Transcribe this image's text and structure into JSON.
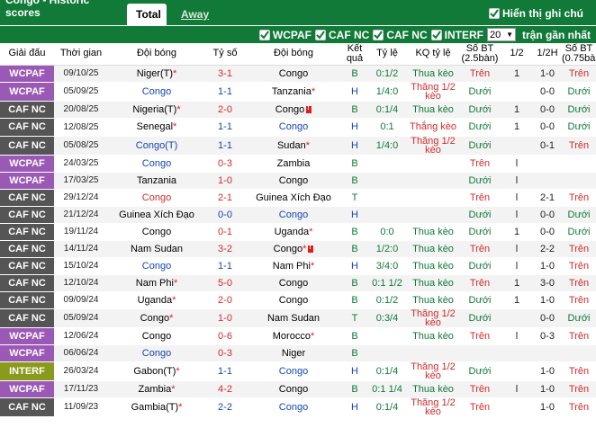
{
  "header": {
    "title": "Congo - Historic scores",
    "tabs": [
      {
        "label": "Total",
        "active": true
      },
      {
        "label": "Away",
        "active": false
      }
    ],
    "show_comment": "Hiển thị ghi chú"
  },
  "filters": {
    "items": [
      "WCPAF",
      "CAF NC",
      "CAF NC",
      "INTERF"
    ],
    "count_value": "20",
    "count_suffix": "trận gần nhất"
  },
  "columns": [
    "Giải đấu",
    "Thời gian",
    "Đội bóng",
    "Tỷ số",
    "Đội bóng",
    "Kết quả",
    "Tỷ lệ",
    "KQ tỷ lệ",
    "Số BT (2.5bàn)",
    "1/2",
    "1/2H",
    "Số BT (0.75bàn)"
  ],
  "colors": {
    "wcpaf": "#9b59b6",
    "cafnc": "#555555",
    "interf": "#8a9a1c",
    "header_green": "#117a38"
  },
  "rows": [
    {
      "league": "WCPAF",
      "date": "09/10/25",
      "home": "Niger(T)",
      "home_star": true,
      "home_congo": false,
      "score": "3-1",
      "score_color": "red",
      "away": "Congo",
      "away_star": false,
      "away_congo": false,
      "loc": "B",
      "line": "0:1/2",
      "res": "Thua kèo",
      "res_type": "thua",
      "ou": "Trên",
      "half": "1",
      "ht": "1-0",
      "ou2": "Trên"
    },
    {
      "league": "WCPAF",
      "date": "05/09/25",
      "home": "Congo",
      "home_star": false,
      "home_congo": true,
      "score": "1-1",
      "score_color": "blue",
      "away": "Tanzania",
      "away_star": true,
      "away_congo": false,
      "loc": "H",
      "line": "1/4:0",
      "res": "Thắng 1/2 kèo",
      "res_type": "thang",
      "ou": "Dưới",
      "half": "",
      "ht": "0-0",
      "ou2": "Dưới"
    },
    {
      "league": "CAF NC",
      "date": "20/08/25",
      "home": "Nigeria(T)",
      "home_star": true,
      "home_congo": false,
      "score": "2-0",
      "score_color": "red",
      "away": "Congo",
      "away_star": false,
      "away_congo": false,
      "away_card": true,
      "loc": "B",
      "line": "0:1/4",
      "res": "Thua kèo",
      "res_type": "thua",
      "ou": "Dưới",
      "half": "1",
      "ht": "0-0",
      "ou2": "Dưới"
    },
    {
      "league": "CAF NC",
      "date": "12/08/25",
      "home": "Senegal",
      "home_star": true,
      "home_congo": false,
      "score": "1-1",
      "score_color": "blue",
      "away": "Congo",
      "away_star": false,
      "away_congo": true,
      "loc": "H",
      "line": "0:1",
      "res": "Thắng kèo",
      "res_type": "thang",
      "ou": "Dưới",
      "half": "1",
      "ht": "0-0",
      "ou2": "Dưới"
    },
    {
      "league": "CAF NC",
      "date": "05/08/25",
      "home": "Congo(T)",
      "home_star": false,
      "home_congo": true,
      "score": "1-1",
      "score_color": "blue",
      "away": "Sudan",
      "away_star": true,
      "away_congo": false,
      "loc": "H",
      "line": "1/4:0",
      "res": "Thắng 1/2 kèo",
      "res_type": "thang",
      "ou": "Dưới",
      "half": "",
      "ht": "0-1",
      "ou2": "Trên"
    },
    {
      "league": "WCPAF",
      "date": "24/03/25",
      "home": "Congo",
      "home_star": false,
      "home_congo": true,
      "score": "0-3",
      "score_color": "red",
      "away": "Zambia",
      "away_star": false,
      "away_congo": false,
      "loc": "B",
      "line": "",
      "res": "",
      "res_type": "",
      "ou": "Trên",
      "half": "l",
      "ht": "",
      "ou2": ""
    },
    {
      "league": "WCPAF",
      "date": "17/03/25",
      "home": "Tanzania",
      "home_star": false,
      "home_congo": false,
      "score": "1-0",
      "score_color": "red",
      "away": "Congo",
      "away_star": false,
      "away_congo": false,
      "loc": "B",
      "line": "",
      "res": "",
      "res_type": "",
      "ou": "Dưới",
      "half": "l",
      "ht": "",
      "ou2": ""
    },
    {
      "league": "CAF NC",
      "date": "29/12/24",
      "home": "Congo",
      "home_star": false,
      "home_congo": false,
      "home_red": true,
      "score": "2-1",
      "score_color": "red",
      "away": "Guinea Xích Đạo",
      "away_star": false,
      "away_congo": false,
      "loc": "T",
      "line": "",
      "res": "",
      "res_type": "",
      "ou": "Trên",
      "half": "l",
      "ht": "2-1",
      "ou2": "Trên"
    },
    {
      "league": "CAF NC",
      "date": "21/12/24",
      "home": "Guinea Xích Đạo",
      "home_star": false,
      "home_congo": false,
      "score": "0-0",
      "score_color": "blue",
      "away": "Congo",
      "away_star": false,
      "away_congo": true,
      "loc": "H",
      "line": "",
      "res": "",
      "res_type": "",
      "ou": "Dưới",
      "half": "l",
      "ht": "0-0",
      "ou2": "Dưới"
    },
    {
      "league": "CAF NC",
      "date": "19/11/24",
      "home": "Congo",
      "home_star": false,
      "home_congo": false,
      "score": "0-1",
      "score_color": "red",
      "away": "Uganda",
      "away_star": true,
      "away_congo": false,
      "loc": "B",
      "line": "0:0",
      "res": "Thua kèo",
      "res_type": "thua",
      "ou": "Dưới",
      "half": "1",
      "ht": "0-0",
      "ou2": "Dưới"
    },
    {
      "league": "CAF NC",
      "date": "14/11/24",
      "home": "Nam Sudan",
      "home_star": false,
      "home_congo": false,
      "score": "3-2",
      "score_color": "red",
      "away": "Congo",
      "away_star": true,
      "away_congo": false,
      "away_card": true,
      "loc": "B",
      "line": "1/2:0",
      "res": "Thua kèo",
      "res_type": "thua",
      "ou": "Trên",
      "half": "l",
      "ht": "2-2",
      "ou2": "Trên"
    },
    {
      "league": "CAF NC",
      "date": "15/10/24",
      "home": "Congo",
      "home_star": false,
      "home_congo": true,
      "score": "1-1",
      "score_color": "blue",
      "away": "Nam Phi",
      "away_star": true,
      "away_congo": false,
      "loc": "H",
      "line": "3/4:0",
      "res": "Thua kèo",
      "res_type": "thua",
      "ou": "Dưới",
      "half": "l",
      "ht": "1-0",
      "ou2": "Trên"
    },
    {
      "league": "CAF NC",
      "date": "12/10/24",
      "home": "Nam Phi",
      "home_star": true,
      "home_congo": false,
      "score": "5-0",
      "score_color": "red",
      "away": "Congo",
      "away_star": false,
      "away_congo": false,
      "loc": "B",
      "line": "0:1 1/2",
      "res": "Thua kèo",
      "res_type": "thua",
      "ou": "Trên",
      "half": "1",
      "ht": "3-0",
      "ou2": "Trên"
    },
    {
      "league": "CAF NC",
      "date": "09/09/24",
      "home": "Uganda",
      "home_star": true,
      "home_congo": false,
      "score": "2-0",
      "score_color": "red",
      "away": "Congo",
      "away_star": false,
      "away_congo": false,
      "loc": "B",
      "line": "0:1/2",
      "res": "Thua kèo",
      "res_type": "thua",
      "ou": "Dưới",
      "half": "1",
      "ht": "1-0",
      "ou2": "Trên"
    },
    {
      "league": "CAF NC",
      "date": "05/09/24",
      "home": "Congo",
      "home_star": true,
      "home_congo": false,
      "score": "1-0",
      "score_color": "red",
      "away": "Nam Sudan",
      "away_star": false,
      "away_congo": false,
      "loc": "T",
      "line": "0:3/4",
      "res": "Thắng 1/2 kèo",
      "res_type": "thang",
      "ou": "Dưới",
      "half": "",
      "ht": "0-0",
      "ou2": "Dưới"
    },
    {
      "league": "WCPAF",
      "date": "12/06/24",
      "home": "Congo",
      "home_star": false,
      "home_congo": false,
      "score": "0-6",
      "score_color": "red",
      "away": "Morocco",
      "away_star": true,
      "away_congo": false,
      "loc": "B",
      "line": "",
      "res": "Thua kèo",
      "res_type": "thua",
      "ou": "Trên",
      "half": "l",
      "ht": "0-3",
      "ou2": "Trên"
    },
    {
      "league": "WCPAF",
      "date": "06/06/24",
      "home": "Congo",
      "home_star": false,
      "home_congo": true,
      "score": "0-3",
      "score_color": "red",
      "away": "Niger",
      "away_star": false,
      "away_congo": false,
      "loc": "B",
      "line": "",
      "res": "",
      "res_type": "",
      "ou": "",
      "half": "",
      "ht": "",
      "ou2": ""
    },
    {
      "league": "INTERF",
      "date": "26/03/24",
      "home": "Gabon(T)",
      "home_star": true,
      "home_congo": false,
      "score": "1-1",
      "score_color": "blue",
      "away": "Congo",
      "away_star": false,
      "away_congo": true,
      "loc": "H",
      "line": "0:1/4",
      "res": "Thắng 1/2 kèo",
      "res_type": "thang",
      "ou": "Dưới",
      "half": "",
      "ht": "1-0",
      "ou2": "Trên"
    },
    {
      "league": "WCPAF",
      "date": "17/11/23",
      "home": "Zambia",
      "home_star": true,
      "home_congo": false,
      "score": "4-2",
      "score_color": "red",
      "away": "Congo",
      "away_star": false,
      "away_congo": false,
      "loc": "B",
      "line": "0:1 1/4",
      "res": "Thua kèo",
      "res_type": "thua",
      "ou": "Trên",
      "half": "l",
      "ht": "1-0",
      "ou2": "Trên"
    },
    {
      "league": "CAF NC",
      "date": "11/09/23",
      "home": "Gambia(T)",
      "home_star": true,
      "home_congo": false,
      "score": "2-2",
      "score_color": "blue",
      "away": "Congo",
      "away_star": false,
      "away_congo": true,
      "loc": "H",
      "line": "0:1/4",
      "res": "Thắng 1/2 kèo",
      "res_type": "thang",
      "ou": "Trên",
      "half": "",
      "ht": "1-0",
      "ou2": "Trên"
    }
  ]
}
